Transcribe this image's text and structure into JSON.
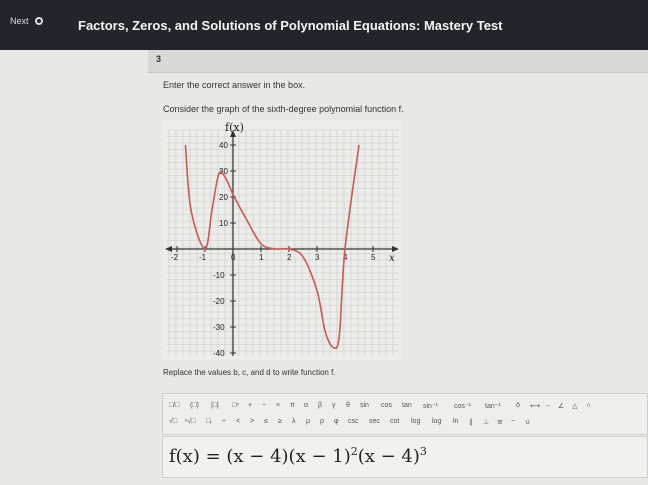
{
  "header": {
    "next_label": "Next",
    "title": "Factors, Zeros, and Solutions of Polynomial Equations: Mastery Test"
  },
  "question": {
    "number": "3",
    "instruction": "Enter the correct answer in the box.",
    "prompt": "Consider the graph of the sixth-degree polynomial function f.",
    "replace_text": "Replace the values b, c, and d to write function f."
  },
  "graph": {
    "y_label": "f(x)",
    "x_label": "x",
    "x_ticks": [
      "-2",
      "-1",
      "0",
      "1",
      "2",
      "3",
      "4",
      "5"
    ],
    "y_ticks": [
      "40",
      "30",
      "20",
      "10",
      "-10",
      "-20",
      "-30",
      "-40"
    ]
  },
  "chart_data": {
    "type": "line",
    "title": "",
    "xlabel": "x",
    "ylabel": "f(x)",
    "xlim": [
      -2,
      5.5
    ],
    "ylim": [
      -40,
      40
    ],
    "grid": true,
    "x": [
      -1.7,
      -1.5,
      -1.0,
      -0.75,
      -0.5,
      -0.25,
      0,
      0.5,
      1.0,
      1.5,
      2.0,
      2.5,
      3.0,
      3.3,
      3.6,
      3.8,
      4.0,
      4.5
    ],
    "y": [
      40,
      15,
      0,
      15,
      29,
      27,
      21,
      11,
      2,
      0,
      0,
      -3,
      -16,
      -32,
      -38,
      -33,
      0,
      40
    ]
  },
  "toolbar": {
    "row1": [
      "□/□",
      "(□)",
      "|□|",
      "□ⁿ",
      "+",
      "−",
      "×",
      "π",
      "α",
      "β",
      "γ",
      "θ",
      "sin",
      "cos",
      "tan",
      "sin⁻¹",
      "cos⁻¹",
      "tan⁻¹",
      "ō",
      "⟷",
      "→",
      "∠",
      "△",
      "∩"
    ],
    "row2": [
      "√□",
      "ⁿ√□",
      "□ᵢ",
      "÷",
      "<",
      ">",
      "≤",
      "≥",
      "λ",
      "μ",
      "ρ",
      "φ",
      "csc",
      "sec",
      "cot",
      "log",
      "log",
      "ln",
      "∥",
      "⊥",
      "≅",
      "~",
      "∪"
    ]
  },
  "answer": {
    "text_main": "f(x) = (x − 4)(x − 1)",
    "exp1": "2",
    "text_mid": "(x − 4)",
    "exp2": "3"
  }
}
